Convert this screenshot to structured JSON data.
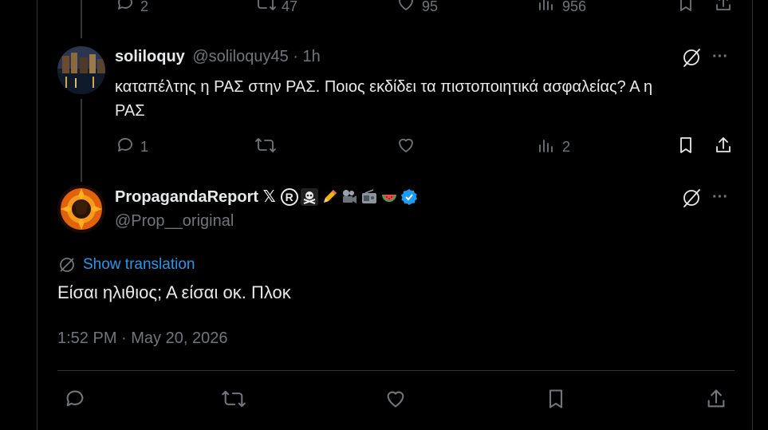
{
  "top_action_bar": {
    "replies": "2",
    "reposts": "47",
    "likes": "95",
    "views": "956"
  },
  "reply_tweet": {
    "display_name": "soliloquy",
    "handle_time": "@soliloquy45 · 1h",
    "text_line1": "καταπέλτης η ΡΑΣ στην ΡΑΣ. Ποιος εκδίδει τα πιστοποιητικά ασφαλείας? Α η",
    "text_line2": "ΡΑΣ",
    "replies": "1",
    "views": "2",
    "more_label": "···"
  },
  "main_tweet": {
    "display_name": "PropagandaReport 𝕏",
    "registered_mark": "R",
    "handle": "@Prop__original",
    "show_translation": "Show translation",
    "text": "Είσαι ηλιθιος; Α είσαι οκ. Πλοκ",
    "timestamp": "1:52 PM · May 20, 2026",
    "more_label": "···",
    "verified_color": "#1d9bf0"
  },
  "colors": {
    "background": "#000000",
    "text_primary": "#e7e9ea",
    "text_secondary": "#71767b",
    "link": "#1d9bf0",
    "divider": "#2f3336"
  }
}
